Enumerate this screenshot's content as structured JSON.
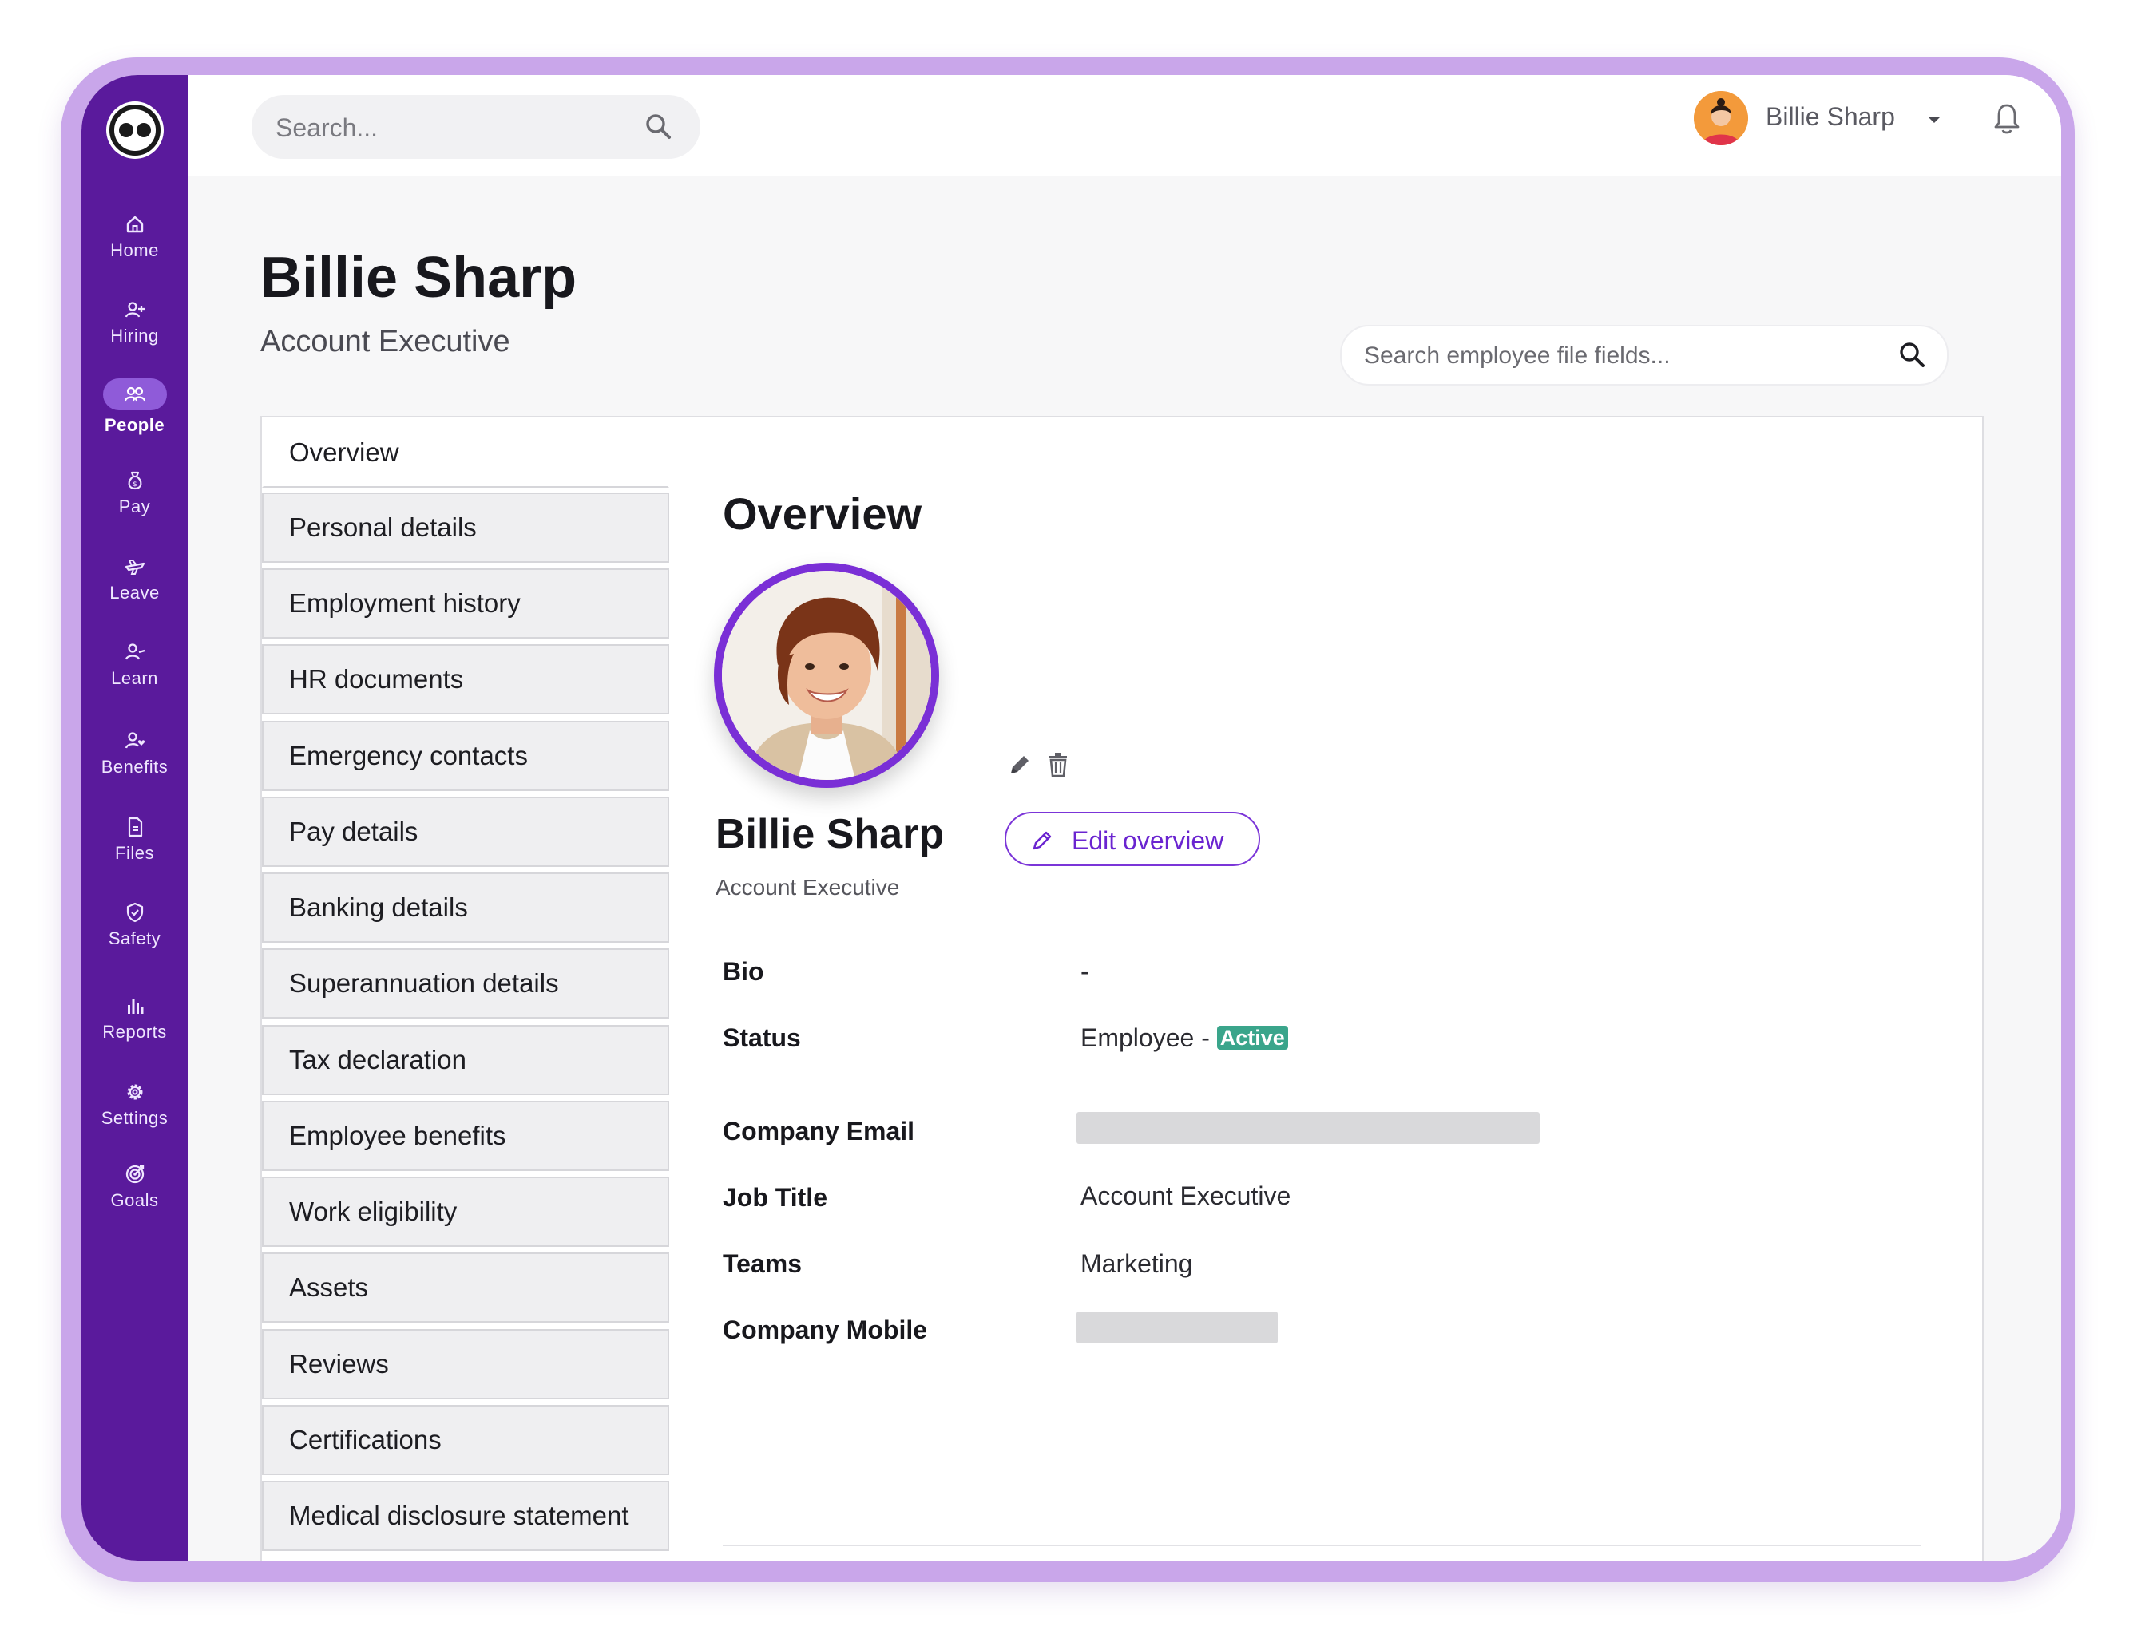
{
  "sidebar": {
    "items": [
      {
        "label": "Home",
        "icon": "home-icon"
      },
      {
        "label": "Hiring",
        "icon": "user-plus-icon"
      },
      {
        "label": "People",
        "icon": "users-icon",
        "active": true
      },
      {
        "label": "Pay",
        "icon": "money-bag-icon"
      },
      {
        "label": "Leave",
        "icon": "plane-icon"
      },
      {
        "label": "Learn",
        "icon": "learn-icon"
      },
      {
        "label": "Benefits",
        "icon": "user-heart-icon"
      },
      {
        "label": "Files",
        "icon": "file-icon"
      },
      {
        "label": "Safety",
        "icon": "shield-icon"
      },
      {
        "label": "Reports",
        "icon": "bar-chart-icon"
      },
      {
        "label": "Settings",
        "icon": "gear-icon"
      },
      {
        "label": "Goals",
        "icon": "target-icon"
      }
    ]
  },
  "topbar": {
    "search_placeholder": "Search...",
    "user_name": "Billie Sharp"
  },
  "header": {
    "name": "Billie Sharp",
    "role": "Account Executive",
    "field_search_placeholder": "Search employee file fields..."
  },
  "tabs": [
    "Overview",
    "Personal details",
    "Employment history",
    "HR documents",
    "Emergency contacts",
    "Pay details",
    "Banking details",
    "Superannuation details",
    "Tax declaration",
    "Employee benefits",
    "Work eligibility",
    "Assets",
    "Reviews",
    "Certifications",
    "Medical disclosure statement"
  ],
  "overview": {
    "title": "Overview",
    "name": "Billie Sharp",
    "role": "Account Executive",
    "edit_label": "Edit overview",
    "fields": {
      "bio_label": "Bio",
      "bio_value": "-",
      "status_label": "Status",
      "status_value": "Employee -",
      "status_badge": "Active",
      "email_label": "Company Email",
      "job_label": "Job Title",
      "job_value": "Account Executive",
      "teams_label": "Teams",
      "teams_value": "Marketing",
      "mobile_label": "Company Mobile"
    }
  },
  "colors": {
    "frame": "#c9a6ea",
    "sidebar": "#5a1a9c",
    "accent": "#7b35d8",
    "active_badge": "#3aa58b"
  }
}
